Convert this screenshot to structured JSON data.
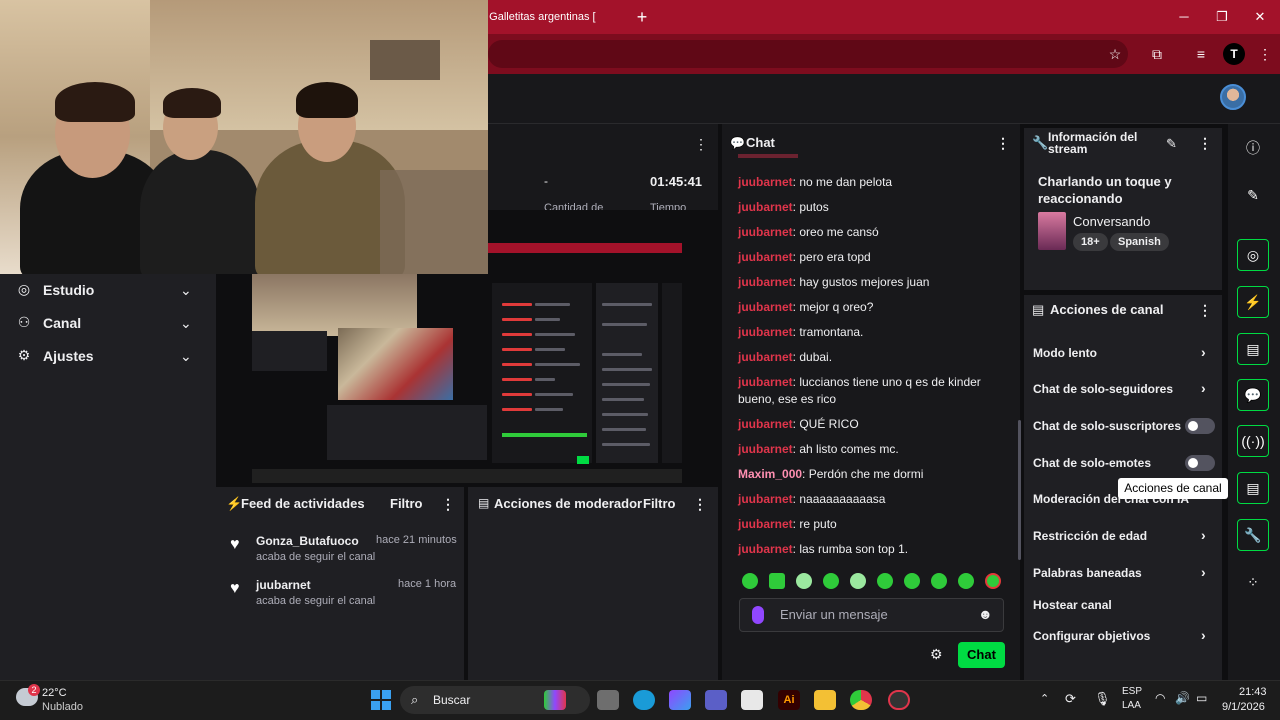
{
  "browser": {
    "tab_title": "a Galletitas argentinas [",
    "new_tab": "+",
    "minimize": "─",
    "maximize": "❐",
    "close": "✕",
    "profile_letter": "T"
  },
  "left_nav": {
    "items": [
      {
        "label": "Estudio",
        "icon": "studio-icon"
      },
      {
        "label": "Canal",
        "icon": "channel-icon"
      },
      {
        "label": "Ajustes",
        "icon": "settings-icon"
      }
    ]
  },
  "stats": {
    "viewers": "-",
    "uptime": "01:45:41",
    "labels": [
      "Cantidad de",
      "Tiempo"
    ]
  },
  "activity_feed": {
    "title": "Feed de actividades",
    "filter": "Filtro",
    "items": [
      {
        "user": "Gonza_Butafuoco",
        "time": "hace 21 minutos",
        "desc": "acaba de seguir el canal"
      },
      {
        "user": "juubarnet",
        "time": "hace 1 hora",
        "desc": "acaba de seguir el canal"
      }
    ]
  },
  "mod_actions": {
    "title": "Acciones de moderador",
    "filter": "Filtro"
  },
  "chat": {
    "title": "Chat",
    "messages": [
      {
        "user": "juubarnet",
        "text": "no me dan pelota",
        "color": "#e0354b"
      },
      {
        "user": "juubarnet",
        "text": "putos",
        "color": "#e0354b"
      },
      {
        "user": "juubarnet",
        "text": "oreo me cansó",
        "color": "#e0354b"
      },
      {
        "user": "juubarnet",
        "text": "pero era topd",
        "color": "#e0354b"
      },
      {
        "user": "juubarnet",
        "text": "hay gustos mejores juan",
        "color": "#e0354b"
      },
      {
        "user": "juubarnet",
        "text": "mejor q oreo?",
        "color": "#e0354b"
      },
      {
        "user": "juubarnet",
        "text": "tramontana.",
        "color": "#e0354b"
      },
      {
        "user": "juubarnet",
        "text": "dubai.",
        "color": "#e0354b"
      },
      {
        "user": "juubarnet",
        "text": "luccianos tiene uno q es de kinder bueno, ese es rico",
        "color": "#e0354b"
      },
      {
        "user": "juubarnet",
        "text": "QUÉ RICO",
        "color": "#e0354b"
      },
      {
        "user": "juubarnet",
        "text": "ah listo comes mc.",
        "color": "#e0354b"
      },
      {
        "user": "Maxim_000",
        "text": "Perdón che me dormi",
        "color": "#ff8fb1"
      },
      {
        "user": "juubarnet",
        "text": "naaaaaaaaaasa",
        "color": "#e0354b"
      },
      {
        "user": "juubarnet",
        "text": "re puto",
        "color": "#e0354b"
      },
      {
        "user": "juubarnet",
        "text": "las rumba son top 1.",
        "color": "#e0354b"
      }
    ],
    "input_placeholder": "Enviar un mensaje",
    "send_label": "Chat"
  },
  "stream_info": {
    "title": "Información del stream",
    "stream_title": "Charlando un toque y reaccionando",
    "category": "Conversando",
    "tags": [
      "18+",
      "Spanish"
    ]
  },
  "channel_actions": {
    "title": "Acciones de canal",
    "items": [
      {
        "label": "Modo lento",
        "control": "chevron"
      },
      {
        "label": "Chat de solo-seguidores",
        "control": "chevron"
      },
      {
        "label": "Chat de solo-suscriptores",
        "control": "toggle",
        "on": false
      },
      {
        "label": "Chat de solo-emotes",
        "control": "toggle",
        "on": false
      },
      {
        "label": "Moderación del chat con IA",
        "control": "chevron"
      },
      {
        "label": "Restricción de edad",
        "control": "chevron"
      },
      {
        "label": "Palabras baneadas",
        "control": "chevron"
      },
      {
        "label": "Hostear canal",
        "control": "none"
      },
      {
        "label": "Configurar objetivos",
        "control": "chevron"
      }
    ],
    "tooltip": "Acciones de canal"
  },
  "taskbar": {
    "weather_temp": "22°C",
    "weather_desc": "Nublado",
    "search_label": "Buscar",
    "lang_top": "ESP",
    "lang_bottom": "LAA",
    "time": "21:43",
    "date": "9/1/2026",
    "weather_badge": "2"
  },
  "colors": {
    "accent": "#00db43",
    "browser_red": "#a3122a",
    "panel": "#1f1f23"
  }
}
